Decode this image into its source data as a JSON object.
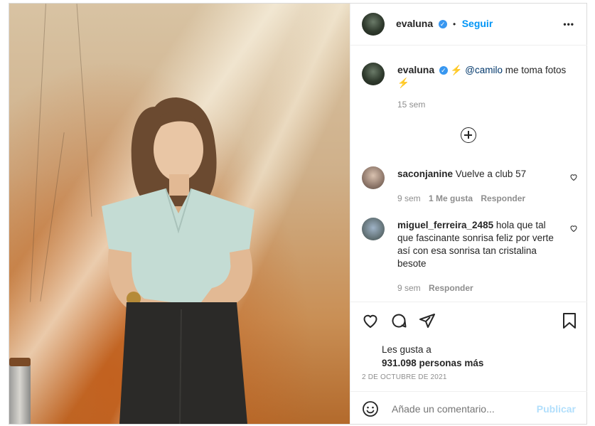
{
  "post": {
    "username": "evaluna",
    "follow_label": "Seguir",
    "dot": "•",
    "more_label": "•••",
    "caption_mention": "@camilo",
    "caption_text": " me toma fotos",
    "caption_time": "15 sem"
  },
  "comments": [
    {
      "username": "saconjanine",
      "text": "Vuelve a club 57",
      "time": "9 sem",
      "likes": "1 Me gusta",
      "reply": "Responder"
    },
    {
      "username": "miguel_ferreira_2485",
      "text": " hola que tal que fascinante sonrisa feliz por verte así con esa sonrisa tan cristalina besote",
      "time": "9 sem",
      "reply": "Responder"
    }
  ],
  "likes": {
    "line1": "Les gusta a",
    "line2": "931.098 personas más"
  },
  "date": "2 DE OCTUBRE DE 2021",
  "comment_box": {
    "placeholder": "Añade un comentario...",
    "publish": "Publicar"
  },
  "colors": {
    "accent": "#0095f6",
    "publish_disabled": "#b2dffc",
    "verified": "#3897f0"
  }
}
